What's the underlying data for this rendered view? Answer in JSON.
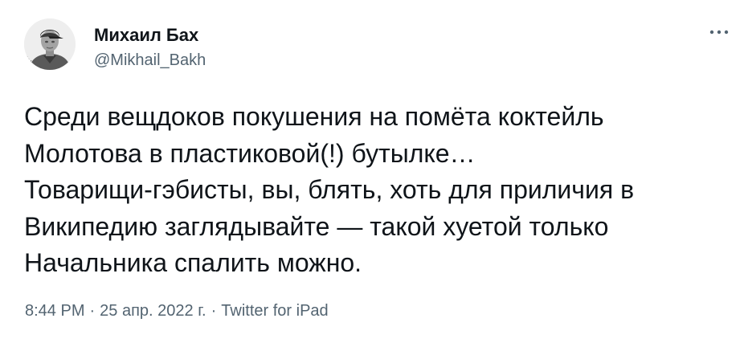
{
  "author": {
    "name": "Михаил Бах",
    "handle": "@Mikhail_Bakh"
  },
  "tweet": {
    "text": "Среди вещдоков покушения на помёта коктейль\nМолотова в пластиковой(!) бутылке…\nТоварищи-гэбисты, вы, блять, хоть для приличия в\nВикипедию заглядывайте — такой хуетой только\nНачальника спалить можно.",
    "time": "8:44 PM",
    "date": "25 апр. 2022 г.",
    "source": "Twitter for iPad",
    "separator": "·"
  },
  "icons": {
    "avatar": "user-avatar-photo",
    "more": "more-dots-icon"
  },
  "colors": {
    "text": "#0f1419",
    "secondary": "#536471"
  }
}
